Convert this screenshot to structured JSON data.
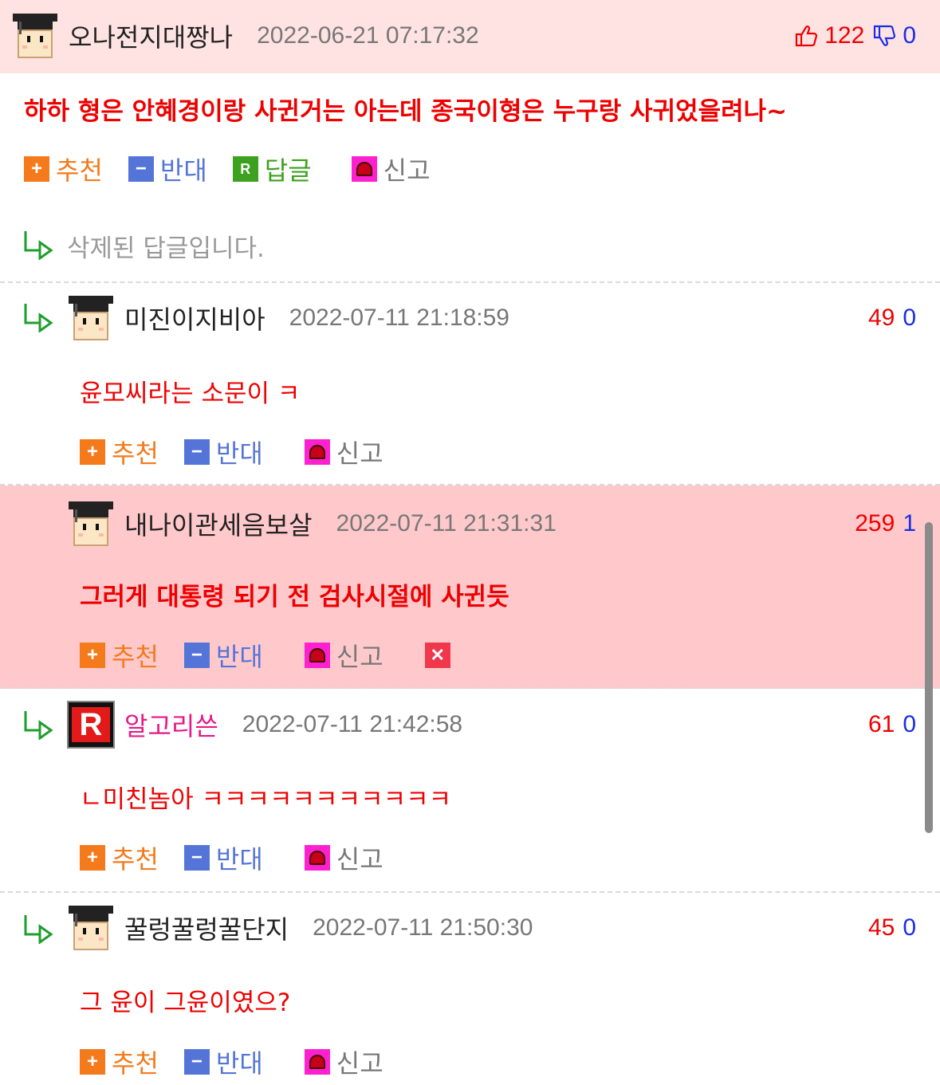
{
  "actions": {
    "recommend": "추천",
    "oppose": "반대",
    "reply": "답글",
    "report": "신고"
  },
  "colors": {
    "best_bg": "#ffe3e3",
    "highlight_bg": "#ffc9cc",
    "upvote": "#ee0000",
    "downvote": "#1a2ee6",
    "recommend": "#f47a1c",
    "oppose": "#5574d8",
    "reply": "#3ca11e"
  },
  "comments": [
    {
      "nickname": "오나전지대짱나",
      "date": "2022-06-21 07:17:32",
      "up": "122",
      "down": "0",
      "text": "하하 형은 안혜경이랑 사귄거는 아는데 종국이형은 누구랑 사귀었을려나~"
    },
    {
      "deleted_text": "삭제된 답글입니다."
    },
    {
      "nickname": "미진이지비아",
      "date": "2022-07-11 21:18:59",
      "up": "49",
      "down": "0",
      "text": "윤모씨라는 소문이 ㅋ"
    },
    {
      "nickname": "내나이관세음보살",
      "date": "2022-07-11 21:31:31",
      "up": "259",
      "down": "1",
      "text": "그러게 대통령 되기 전 검사시절에 사귄듯"
    },
    {
      "nickname": "알고리쓴",
      "avatar_letter": "R",
      "date": "2022-07-11 21:42:58",
      "up": "61",
      "down": "0",
      "text": "ㄴ미친놈아 ㅋㅋㅋㅋㅋㅋㅋㅋㅋㅋㅋ"
    },
    {
      "nickname": "꿀렁꿀렁꿀단지",
      "date": "2022-07-11 21:50:30",
      "up": "45",
      "down": "0",
      "text": "그 윤이 그윤이였으?"
    }
  ]
}
